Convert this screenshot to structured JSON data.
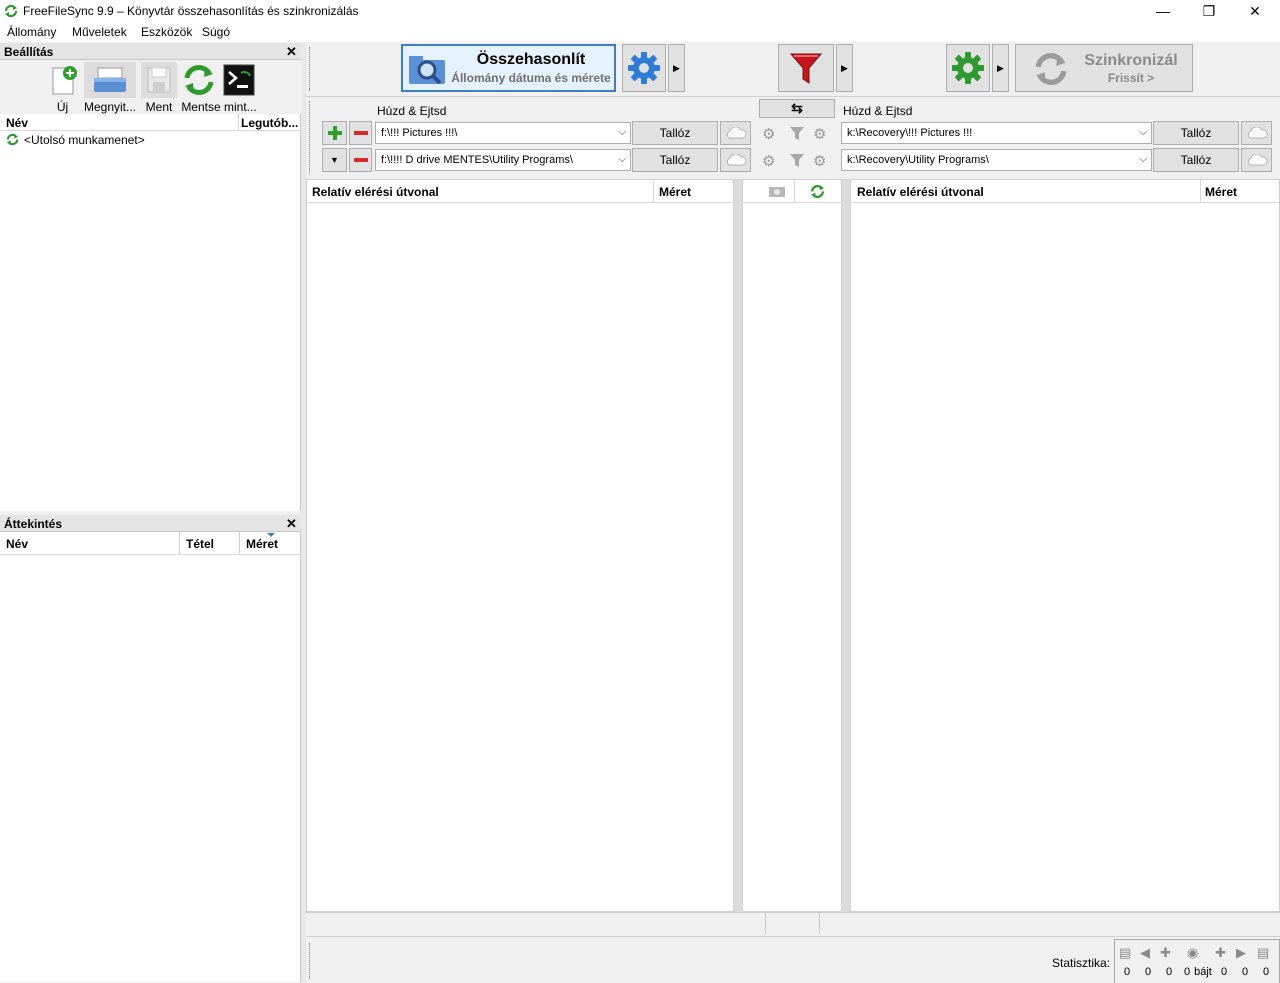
{
  "window": {
    "title": "FreeFileSync 9.9 – Könyvtár összehasonlítás és szinkronizálás",
    "minimize_glyph": "—",
    "restore_glyph": "❐",
    "close_glyph": "✕"
  },
  "menu": [
    "Állomány",
    "Műveletek",
    "Eszközök",
    "Súgó"
  ],
  "config_panel": {
    "title": "Beállítás",
    "toolbar": [
      {
        "label": "Új",
        "icon": "new-file-icon"
      },
      {
        "label": "Megnyit...",
        "icon": "open-folder-icon"
      },
      {
        "label": "Ment",
        "icon": "save-disk-icon"
      },
      {
        "label": "Mentse mint...",
        "icon": "save-as-batch-icon"
      },
      {
        "label": "",
        "icon": "terminal-icon"
      }
    ],
    "col_name": "Név",
    "col_last": "Legutób...",
    "items": [
      {
        "label": "<Utolsó munkamenet>",
        "icon": "sync-icon"
      }
    ]
  },
  "overview_panel": {
    "title": "Áttekintés",
    "col_name": "Név",
    "col_items": "Tétel",
    "col_size": "Méret"
  },
  "top_bar": {
    "compare_label": "Összehasonlít",
    "compare_sub": "Állomány dátuma és mérete",
    "sync_label": "Szinkronizál",
    "sync_sub": "Frissít >"
  },
  "folders": {
    "left_header": "Húzd & Ejtsd",
    "right_header": "Húzd & Ejtsd",
    "swap_glyph": "⇆",
    "browse_label": "Tallóz",
    "pairs": [
      {
        "left": "f:\\!!! Pictures !!!\\",
        "right": "k:\\Recovery\\!!! Pictures !!!"
      },
      {
        "left": "f:\\!!!! D drive MENTES\\Utility Programs\\",
        "right": "k:\\Recovery\\Utility Programs\\"
      }
    ]
  },
  "grid": {
    "left_path_header": "Relatív elérési útvonal",
    "left_size_header": "Méret",
    "right_path_header": "Relatív elérési útvonal",
    "right_size_header": "Méret"
  },
  "statistics": {
    "label": "Statisztika:",
    "values": [
      "0",
      "0",
      "0",
      "0",
      "0",
      "0",
      "0"
    ],
    "bytes_unit": "bájt"
  },
  "colors": {
    "compare_border": "#3c7fc1",
    "compare_bg": "#e5f1fb",
    "filter_red": "#c4161c",
    "gear_blue": "#2e7cd6",
    "gear_green": "#2f9a2f",
    "plus_green": "#2ea02e",
    "minus_red": "#d42a2a"
  }
}
